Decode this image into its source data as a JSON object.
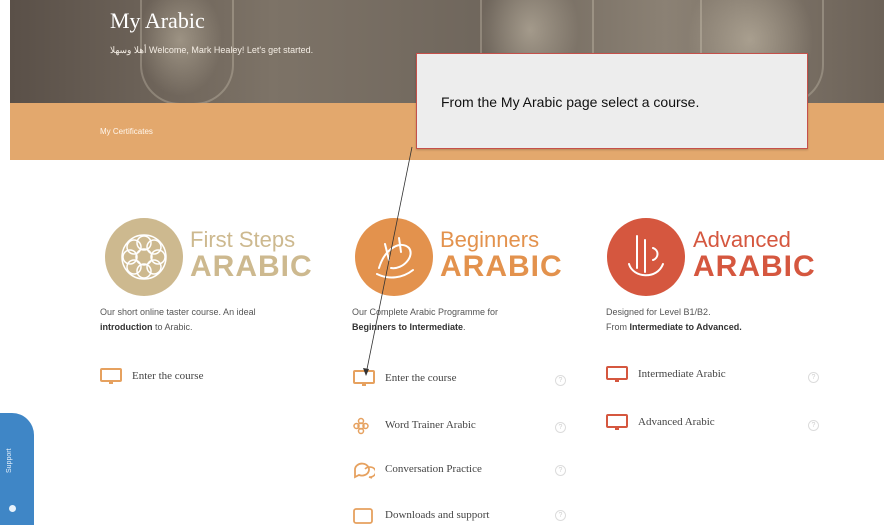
{
  "header": {
    "title": "My Arabic",
    "welcome": "أهلا وسهلا Welcome, Mark Healey! Let's get started.",
    "certificates_link": "My Certificates"
  },
  "callout": {
    "text": "From the My Arabic page select a course."
  },
  "courses": [
    {
      "brand_top": "First Steps",
      "brand_bottom": "ARABIC",
      "color": "#cdb98f",
      "desc_line1_pre": "Our short online taster course. An ideal",
      "desc_line2_bold": "introduction",
      "desc_line2_post": " to Arabic.",
      "links": [
        {
          "label": "Enter the course",
          "icon": "monitor-icon"
        }
      ]
    },
    {
      "brand_top": "Beginners",
      "brand_bottom": "ARABIC",
      "color": "#e3924d",
      "desc_line1_pre": "Our Complete Arabic Programme for",
      "desc_line2_bold": "Beginners to Intermediate",
      "desc_line2_post": ".",
      "links": [
        {
          "label": "Enter the course",
          "icon": "monitor-icon"
        },
        {
          "label": "Word Trainer Arabic",
          "icon": "flower-pattern-icon"
        },
        {
          "label": "Conversation Practice",
          "icon": "chat-bubbles-icon"
        },
        {
          "label": "Downloads and support",
          "icon": "download-icon"
        }
      ]
    },
    {
      "brand_top": "Advanced",
      "brand_bottom": "ARABIC",
      "color": "#d5573f",
      "desc_line1_pre": "Designed for Level B1/B2.",
      "desc_line2_pre": "From ",
      "desc_line2_bold": "Intermediate to Advanced.",
      "desc_line2_post": "",
      "links": [
        {
          "label": "Intermediate Arabic",
          "icon": "monitor-icon"
        },
        {
          "label": "Advanced Arabic",
          "icon": "monitor-icon"
        }
      ]
    }
  ],
  "help_glyph": "?",
  "support_tab": {
    "label": "Support"
  }
}
